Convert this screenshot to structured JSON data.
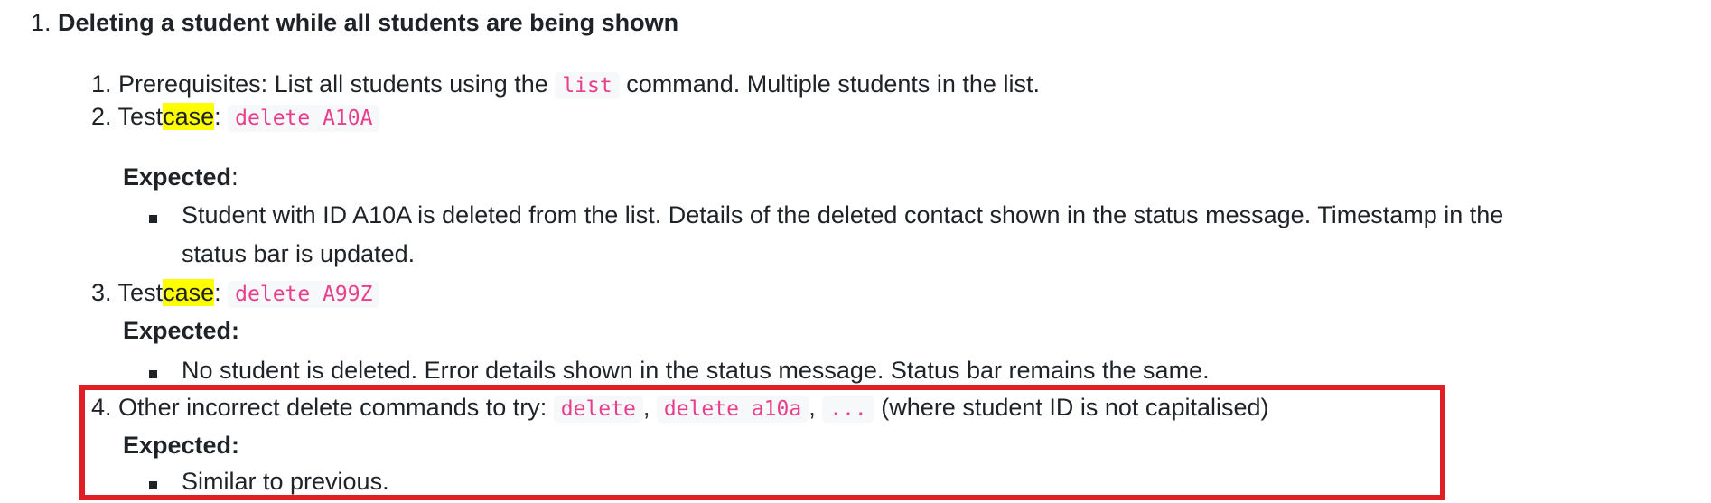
{
  "heading": {
    "number": "1.",
    "text": "Deleting a student while all students are being shown"
  },
  "steps": [
    {
      "number": "1.",
      "prefix": "Prerequisites: List all students using the",
      "code": "list",
      "suffix": "command. Multiple students in the list."
    },
    {
      "number": "2.",
      "test_word": "Test",
      "highlight_word": "case",
      "colon": ":",
      "code": "delete A10A",
      "expected_label": "Expected",
      "expected_colon": ":",
      "bullets": [
        "Student with ID A10A is deleted from the list. Details of the deleted contact shown in the status message. Timestamp in the",
        "status bar is updated."
      ]
    },
    {
      "number": "3.",
      "test_word": "Test",
      "highlight_word": "case",
      "colon": ":",
      "code": "delete A99Z",
      "expected_label": "Expected:",
      "bullets": [
        "No student is deleted. Error details shown in the status message. Status bar remains the same."
      ]
    },
    {
      "number": "4.",
      "prefix": "Other incorrect delete commands to try:",
      "codes": [
        "delete",
        "delete a10a",
        "..."
      ],
      "separator": ",",
      "suffix": "(where student ID is not capitalised)",
      "expected_label": "Expected:",
      "bullets": [
        "Similar to previous."
      ]
    }
  ],
  "colors": {
    "highlight": "#ffff00",
    "code_text": "#e83e8c",
    "annotation_box": "#e01e24"
  }
}
